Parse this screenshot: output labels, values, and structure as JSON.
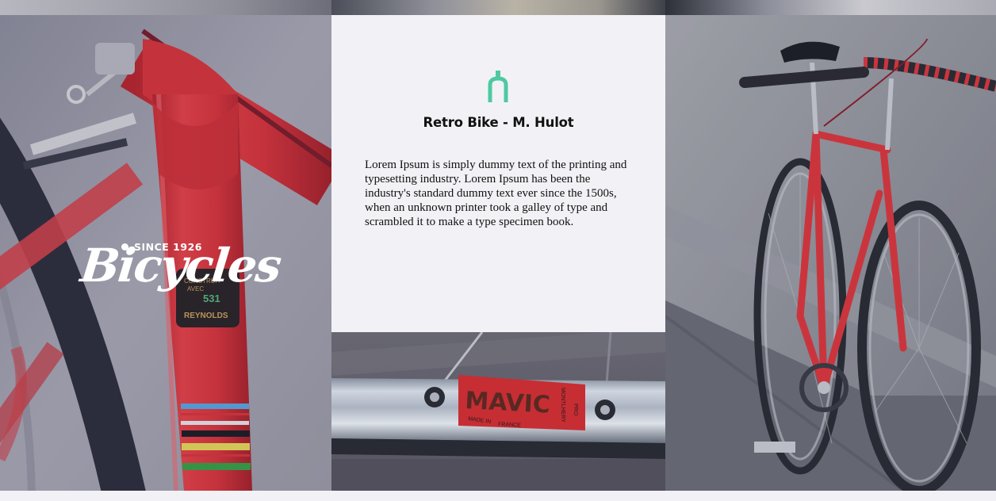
{
  "product": {
    "title": "Retro Bike - M. Hulot",
    "description": "Lorem Ipsum is simply dummy text of the printing and typesetting industry. Lorem Ipsum has been the industry's standard dummy text ever since the 1500s, when an unknown printer took a galley of type and scrambled it to make a type specimen book.",
    "icon": "bike-fork-icon"
  },
  "logo": {
    "tagline": "SINCE 1926",
    "wordmark": "Bicycles"
  },
  "photos": {
    "left_tube_decal": [
      "CONSTRUIT",
      "AVEC",
      "531",
      "REYNOLDS"
    ],
    "rim_sticker": [
      "MAVIC",
      "MADE IN",
      "FRANCE",
      "MONTLHERY",
      "PRO"
    ]
  },
  "colors": {
    "accent": "#4ec9a0",
    "panel_bg": "#f2f2f6",
    "frame_red": "#e0393d"
  }
}
